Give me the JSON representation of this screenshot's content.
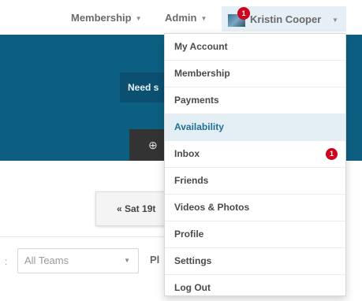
{
  "nav": {
    "membership_label": "Membership",
    "admin_label": "Admin",
    "user_name": "Kristin Cooper",
    "user_badge": "1"
  },
  "hero": {
    "panel_text": "Need s",
    "button_glyph": "⊕"
  },
  "date_nav": {
    "label": "« Sat 19t"
  },
  "filters": {
    "separator": ":",
    "teams_value": "All Teams",
    "pl_text": "Pl"
  },
  "dropdown": {
    "items": [
      {
        "label": "My Account"
      },
      {
        "label": "Membership"
      },
      {
        "label": "Payments"
      },
      {
        "label": "Availability"
      },
      {
        "label": "Inbox",
        "badge": "1"
      },
      {
        "label": "Friends"
      },
      {
        "label": "Videos & Photos"
      },
      {
        "label": "Profile"
      },
      {
        "label": "Settings"
      },
      {
        "label": "Log Out"
      }
    ],
    "active_index": 3
  },
  "colors": {
    "hero_bg": "#0d5f82",
    "badge": "#d0021b",
    "active_item_bg": "#e4eff5"
  }
}
